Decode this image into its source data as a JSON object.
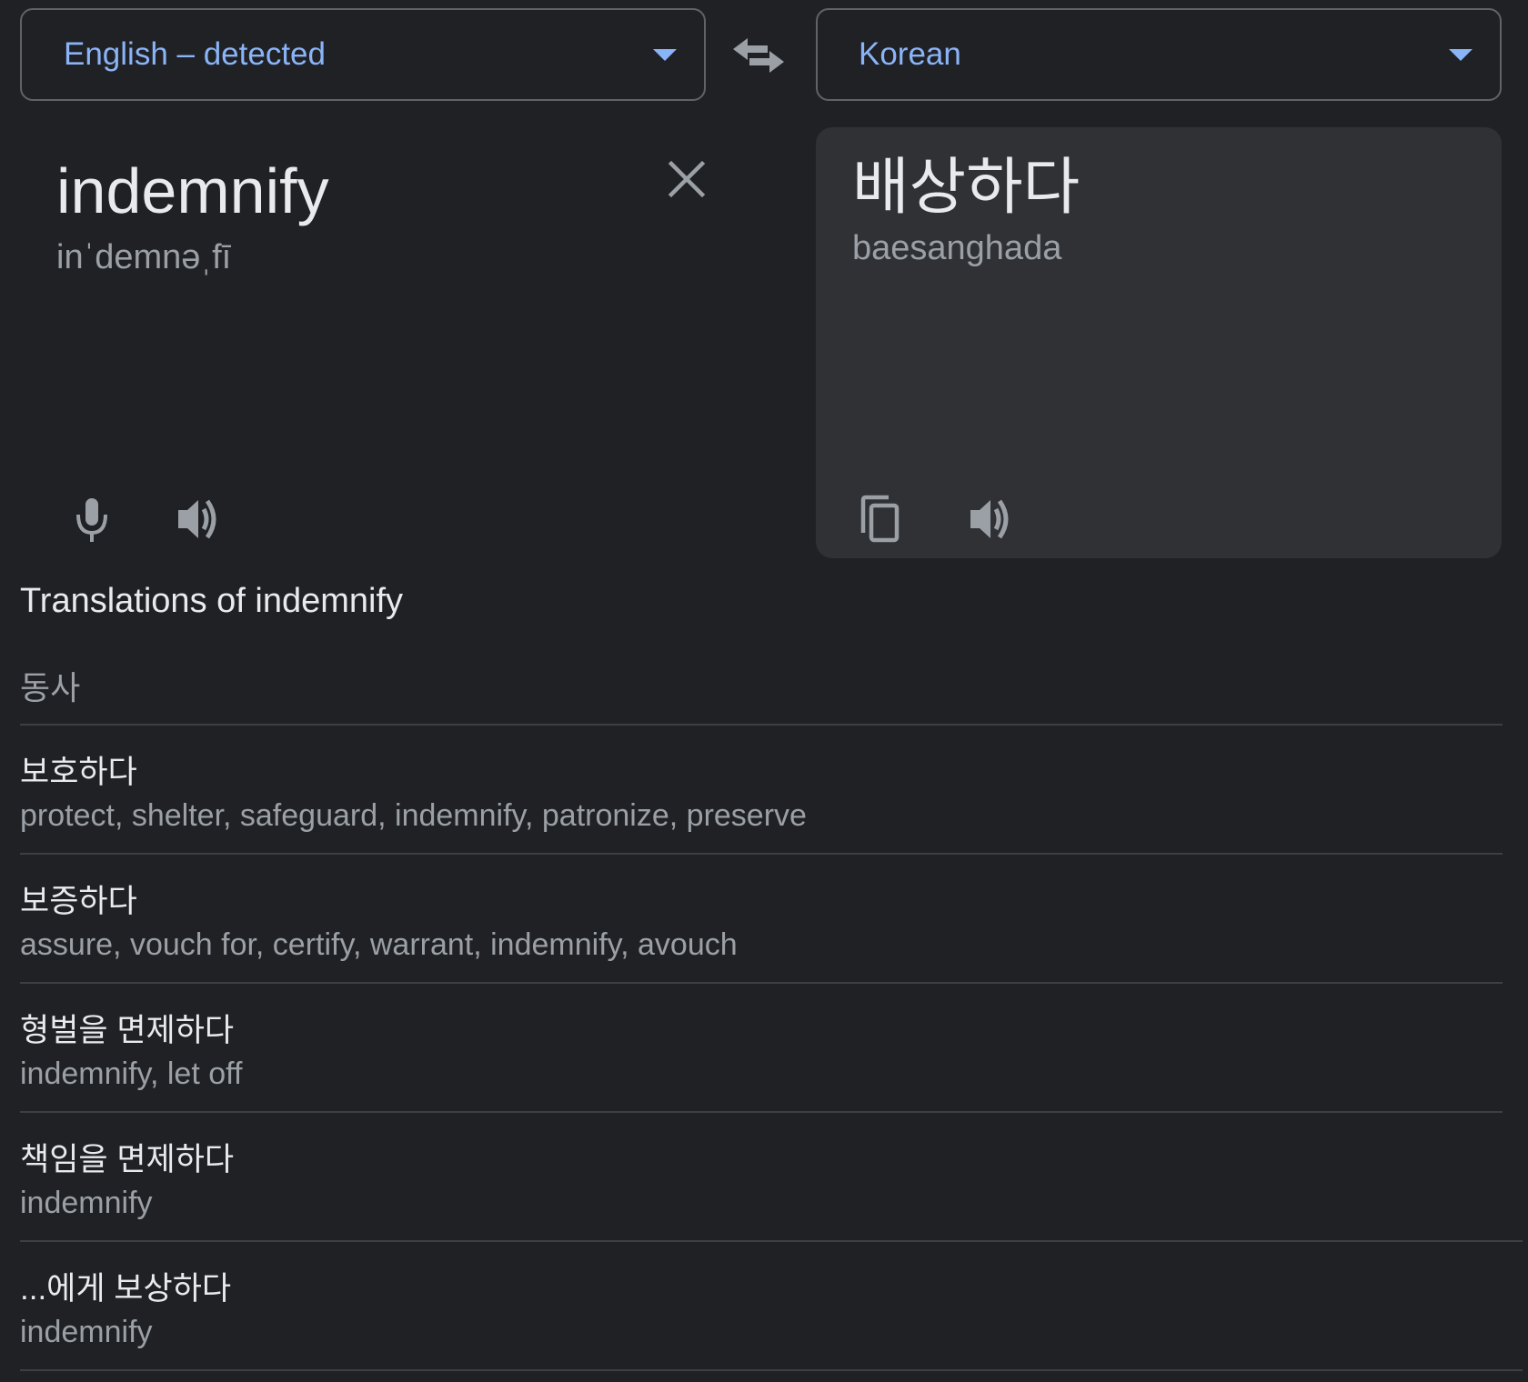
{
  "source_language": {
    "label": "English – detected"
  },
  "target_language": {
    "label": "Korean"
  },
  "source": {
    "text": "indemnify",
    "phonetic": "inˈdemnəˌfī"
  },
  "target": {
    "text": "배상하다",
    "romanization": "baesanghada"
  },
  "translations": {
    "heading": "Translations of indemnify",
    "part_of_speech": "동사",
    "entries": [
      {
        "word": "보호하다",
        "synonyms": "protect, shelter, safeguard, indemnify, patronize, preserve"
      },
      {
        "word": "보증하다",
        "synonyms": "assure, vouch for, certify, warrant, indemnify, avouch"
      },
      {
        "word": "형벌을 면제하다",
        "synonyms": "indemnify, let off"
      },
      {
        "word": "책임을 면제하다",
        "synonyms": "indemnify"
      },
      {
        "word": "...에게 보상하다",
        "synonyms": "indemnify"
      }
    ]
  },
  "icons": {
    "swap": "swap-arrows-icon",
    "clear": "close-icon",
    "mic": "microphone-icon",
    "speaker": "speaker-icon",
    "copy": "copy-icon",
    "dropdown": "chevron-down-icon"
  },
  "colors": {
    "background": "#202124",
    "panel": "#303134",
    "accent": "#8ab4f8",
    "text_primary": "#e8eaed",
    "text_secondary": "#9aa0a6",
    "divider": "#3c4043"
  }
}
